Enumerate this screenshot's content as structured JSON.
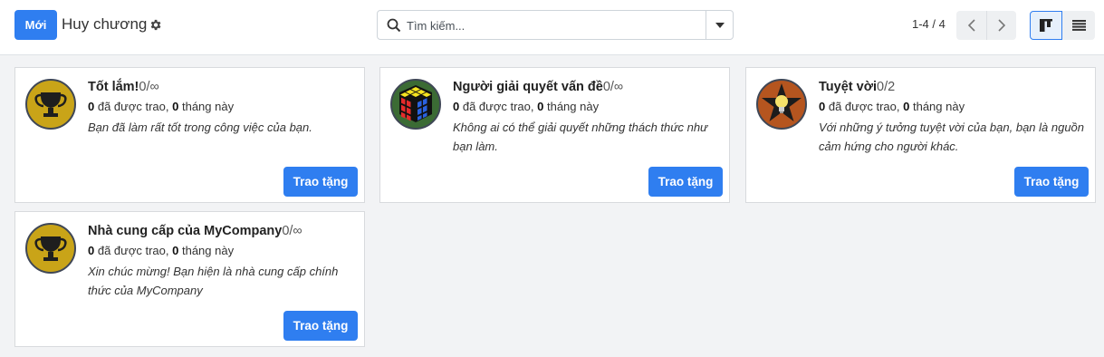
{
  "header": {
    "new_button": "Mới",
    "breadcrumb": "Huy chương",
    "search_placeholder": "Tìm kiếm...",
    "pager": "1-4 / 4"
  },
  "colors": {
    "accent": "#2f7ef0"
  },
  "cards": [
    {
      "title": "Tốt lắm!",
      "count": "0/∞",
      "granted": "0",
      "granted_label": " đã được trao, ",
      "month": "0",
      "month_label": " tháng này",
      "description": "Bạn đã làm rất tốt trong công việc của bạn.",
      "button": "Trao tặng",
      "icon": "trophy-icon"
    },
    {
      "title": "Người giải quyết vấn đề",
      "count": "0/∞",
      "granted": "0",
      "granted_label": " đã được trao, ",
      "month": "0",
      "month_label": " tháng này",
      "description": "Không ai có thể giải quyết những thách thức như bạn làm.",
      "button": "Trao tặng",
      "icon": "rubiks-cube-icon"
    },
    {
      "title": "Tuyệt vời",
      "count": "0/2",
      "granted": "0",
      "granted_label": " đã được trao, ",
      "month": "0",
      "month_label": " tháng này",
      "description": "Với những ý tưởng tuyệt vời của bạn, bạn là nguồn cảm hứng cho người khác.",
      "button": "Trao tặng",
      "icon": "lightbulb-star-icon"
    },
    {
      "title": "Nhà cung cấp của MyCompany",
      "count": "0/∞",
      "granted": "0",
      "granted_label": " đã được trao, ",
      "month": "0",
      "month_label": " tháng này",
      "description": "Xin chúc mừng! Bạn hiện là nhà cung cấp chính thức của MyCompany",
      "button": "Trao tặng",
      "icon": "trophy-icon"
    }
  ]
}
